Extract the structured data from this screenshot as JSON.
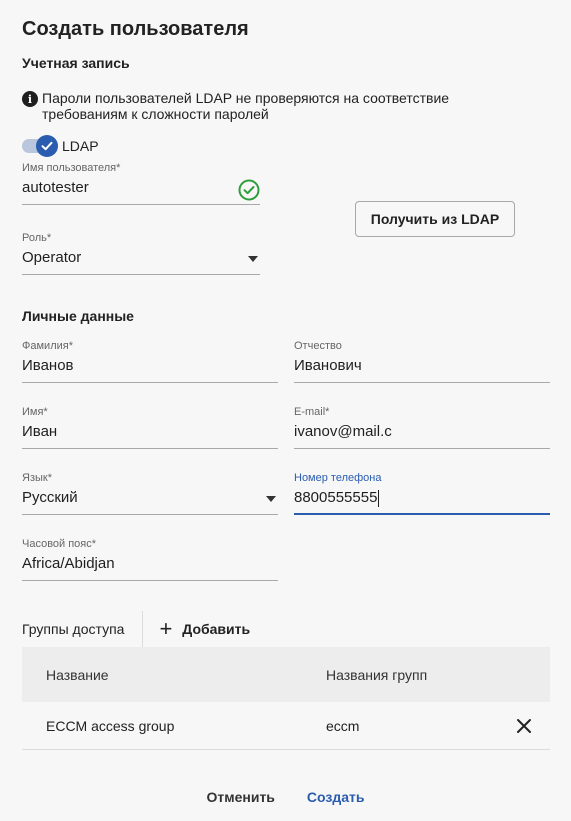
{
  "dialog": {
    "title": "Создать пользователя"
  },
  "account": {
    "section_title": "Учетная запись",
    "info_icon": "info-icon",
    "info_text": "Пароли пользователей LDAP не проверяются на соответствие требованиям к сложности паролей",
    "ldap_toggle": {
      "label": "LDAP",
      "checked": true
    },
    "username": {
      "label": "Имя пользователя*",
      "value": "autotester",
      "status_icon": "check-circle-icon"
    },
    "get_from_ldap_label": "Получить из LDAP",
    "role": {
      "label": "Роль*",
      "value": "Operator"
    }
  },
  "personal": {
    "section_title": "Личные данные",
    "last_name": {
      "label": "Фамилия*",
      "value": "Иванов"
    },
    "patronymic": {
      "label": "Отчество",
      "value": "Иванович"
    },
    "first_name": {
      "label": "Имя*",
      "value": "Иван"
    },
    "email": {
      "label": "E-mail*",
      "value": "ivanov@mail.c"
    },
    "language": {
      "label": "Язык*",
      "value": "Русский"
    },
    "phone": {
      "label": "Номер телефона",
      "value": "8800555555"
    },
    "timezone": {
      "label": "Часовой пояс*",
      "value": "Africa/Abidjan"
    }
  },
  "groups": {
    "title": "Группы доступа",
    "add_label": "Добавить",
    "columns": [
      "Название",
      "Названия групп"
    ],
    "rows": [
      {
        "name": "ECCM access group",
        "group_names": "eccm"
      }
    ]
  },
  "footer": {
    "cancel_label": "Отменить",
    "create_label": "Создать"
  },
  "colors": {
    "accent": "#2a5db0",
    "success": "#2e9e3c",
    "background": "#f7f7f7"
  }
}
